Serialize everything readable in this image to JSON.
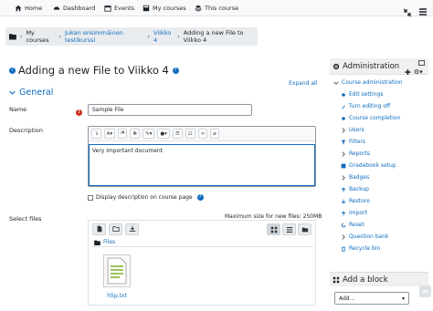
{
  "navbar": {
    "items": [
      {
        "label": "Home",
        "icon": "home-icon"
      },
      {
        "label": "Dashboard",
        "icon": "dashboard-icon"
      },
      {
        "label": "Events",
        "icon": "calendar-icon"
      },
      {
        "label": "My courses",
        "icon": "courses-icon"
      },
      {
        "label": "This course",
        "icon": "layers-icon"
      }
    ]
  },
  "breadcrumb": {
    "items": [
      "My courses",
      "Jukan ensimmäinen testikurssi",
      "Viikko 4",
      "Adding a new File to Viikko 4"
    ]
  },
  "page": {
    "title": "Adding a new File to Viikko 4",
    "section": "General",
    "expand_all": "Expand all"
  },
  "form": {
    "name_label": "Name",
    "name_value": "Sample File",
    "description_label": "Description",
    "description_value": "Very important document",
    "display_description": "Display description on course page",
    "select_files_label": "Select files",
    "max_size": "Maximum size for new files: 250MB",
    "files_crumb": "Files",
    "file_name": "h5p.txt"
  },
  "sidebar": {
    "title": "Administration",
    "items": [
      {
        "label": "Course administration",
        "level": 0
      },
      {
        "label": "Edit settings",
        "level": 1
      },
      {
        "label": "Turn editing off",
        "level": 1
      },
      {
        "label": "Course completion",
        "level": 1
      },
      {
        "label": "Users",
        "level": 1
      },
      {
        "label": "Filters",
        "level": 1
      },
      {
        "label": "Reports",
        "level": 1
      },
      {
        "label": "Gradebook setup",
        "level": 1
      },
      {
        "label": "Badges",
        "level": 1
      },
      {
        "label": "Backup",
        "level": 1
      },
      {
        "label": "Restore",
        "level": 1
      },
      {
        "label": "Import",
        "level": 1
      },
      {
        "label": "Reset",
        "level": 1
      },
      {
        "label": "Question bank",
        "level": 1
      },
      {
        "label": "Recycle bin",
        "level": 1
      }
    ]
  },
  "addblock": {
    "title": "Add a block",
    "select_value": "Add..."
  }
}
